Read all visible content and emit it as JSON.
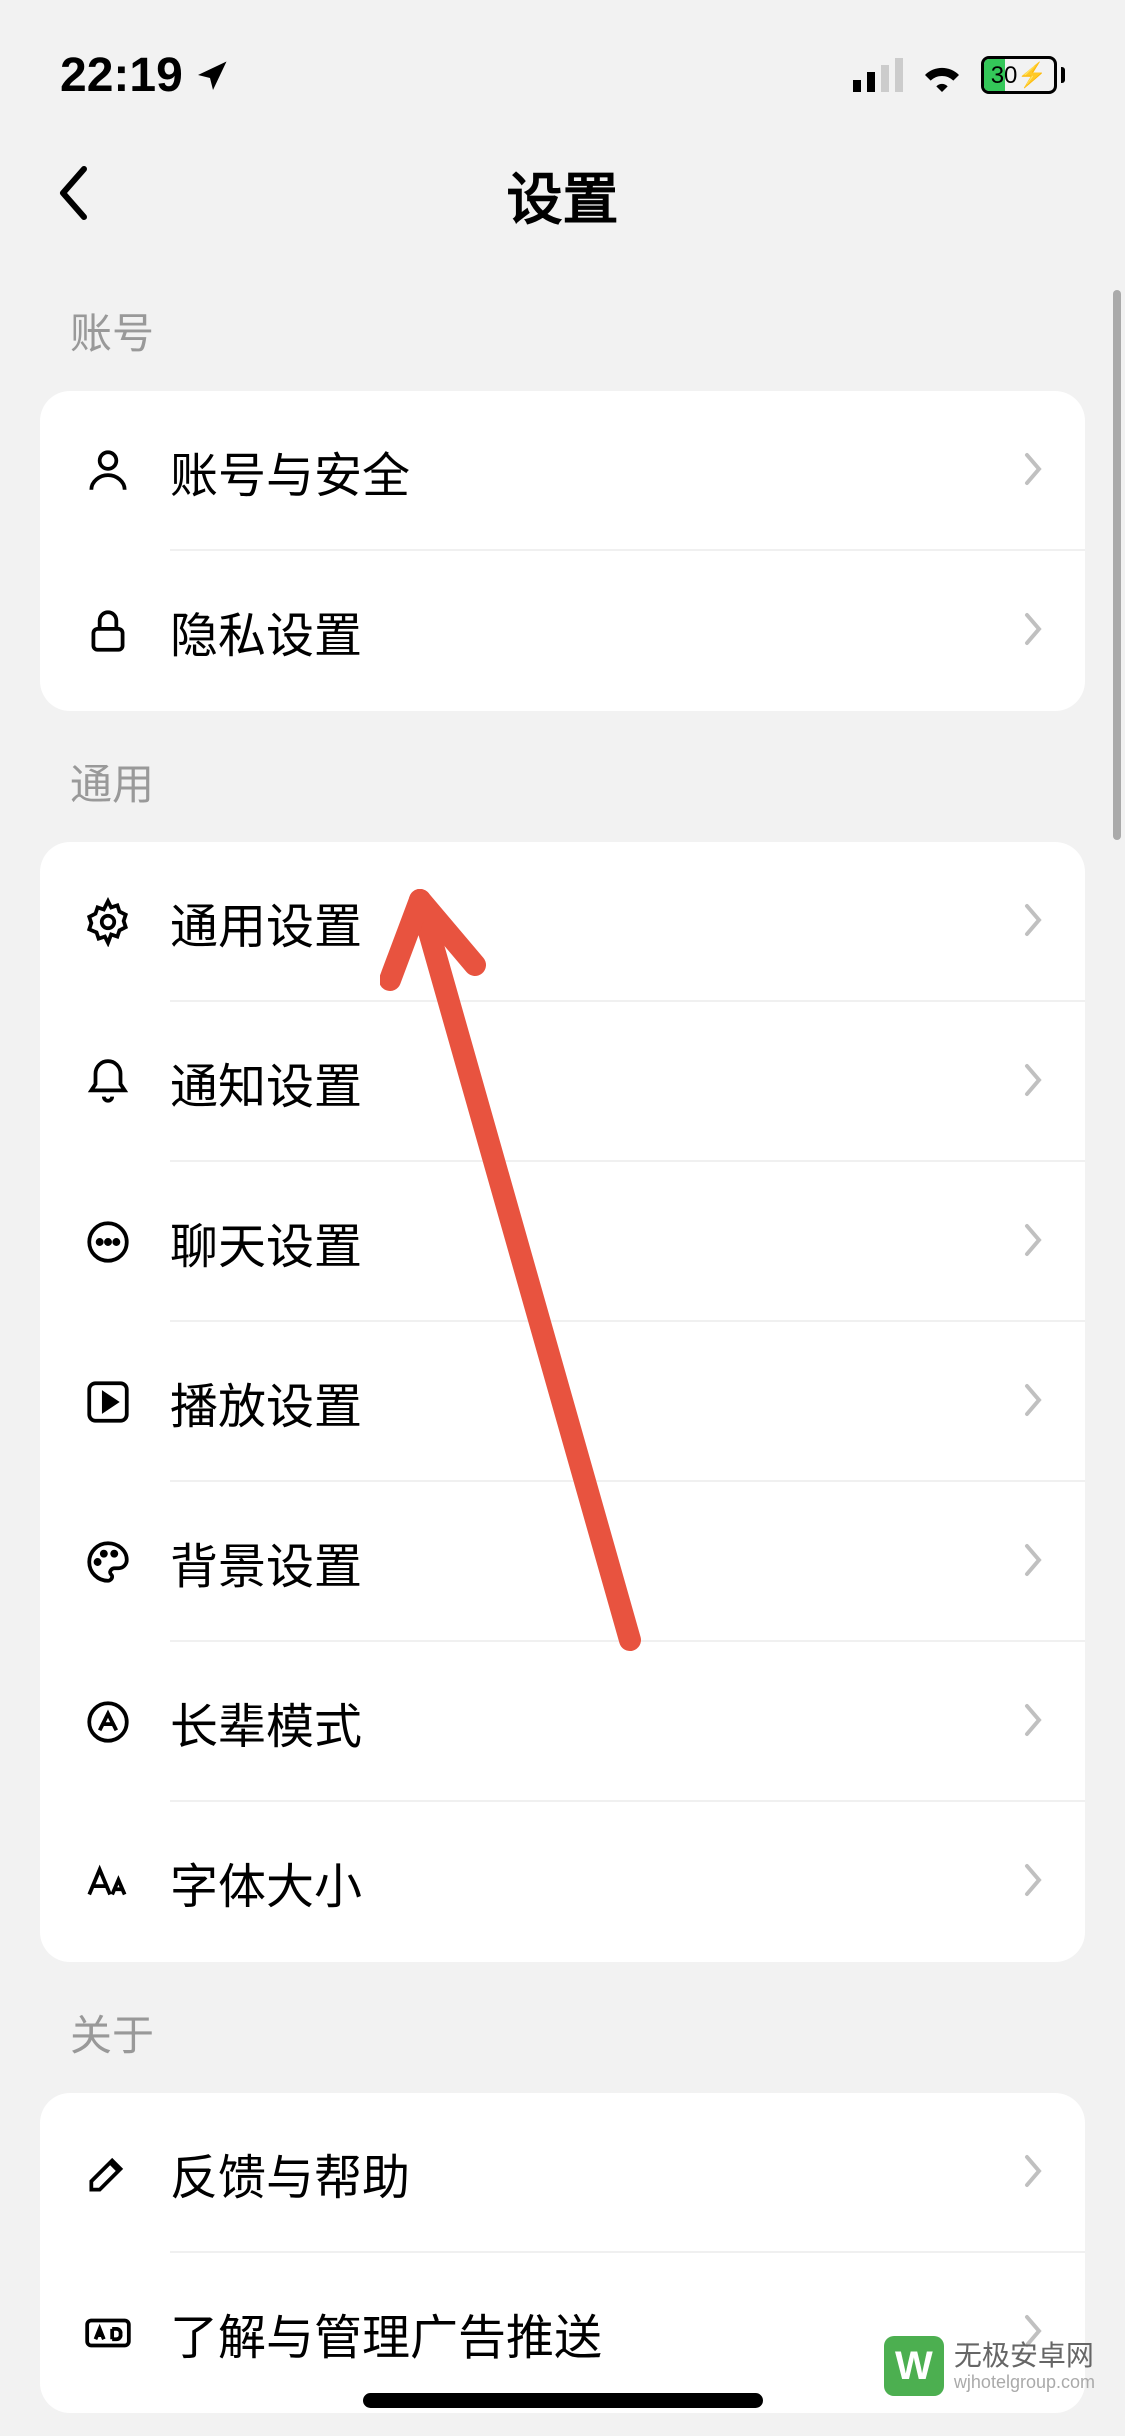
{
  "status_bar": {
    "time": "22:19",
    "battery_percent": "30",
    "charging_glyph": "⚡"
  },
  "nav": {
    "title": "设置"
  },
  "sections": {
    "account": {
      "header": "账号",
      "items": [
        {
          "icon": "person-icon",
          "label": "账号与安全"
        },
        {
          "icon": "lock-icon",
          "label": "隐私设置"
        }
      ]
    },
    "general": {
      "header": "通用",
      "items": [
        {
          "icon": "gear-icon",
          "label": "通用设置"
        },
        {
          "icon": "bell-icon",
          "label": "通知设置"
        },
        {
          "icon": "chat-icon",
          "label": "聊天设置"
        },
        {
          "icon": "play-icon",
          "label": "播放设置"
        },
        {
          "icon": "palette-icon",
          "label": "背景设置"
        },
        {
          "icon": "elder-icon",
          "label": "长辈模式"
        },
        {
          "icon": "font-icon",
          "label": "字体大小"
        }
      ]
    },
    "about": {
      "header": "关于",
      "items": [
        {
          "icon": "pencil-icon",
          "label": "反馈与帮助"
        },
        {
          "icon": "ad-icon",
          "label": "了解与管理广告推送"
        }
      ]
    }
  },
  "watermark": {
    "logo_text": "W",
    "title": "无极安卓网",
    "subtitle": "wjhotelgroup.com"
  }
}
